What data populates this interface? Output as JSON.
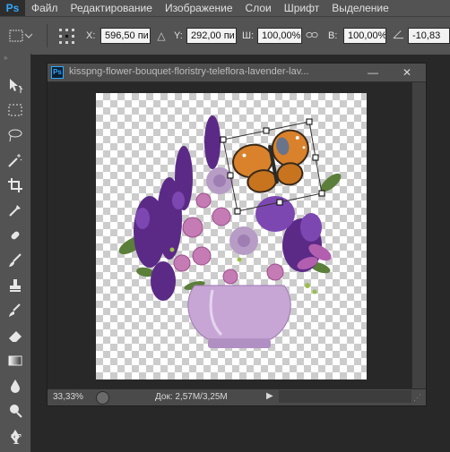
{
  "menubar": {
    "logo": "Ps",
    "items": [
      "Файл",
      "Редактирование",
      "Изображение",
      "Слои",
      "Шрифт",
      "Выделение"
    ]
  },
  "options_bar": {
    "x_label": "X:",
    "x_value": "596,50 пи",
    "y_label": "Y:",
    "y_value": "292,00 пи",
    "w_label": "Ш:",
    "w_value": "100,00%",
    "h_label": "В:",
    "h_value": "100,00%",
    "angle_value": "-10,83"
  },
  "document": {
    "ps_icon": "Ps",
    "title": "kisspng-flower-bouquet-floristry-teleflora-lavender-lav...",
    "minimize": "—",
    "close": "✕",
    "zoom": "33,33%",
    "doc_info": "Док: 2,57M/3,25M",
    "status_arrow": "▶"
  },
  "colors": {
    "ui_dark": "#282828",
    "panel": "#535353",
    "accent_ps": "#31a8ff",
    "purple_flowers": "#5b2a86",
    "butterfly_orange": "#d9822b"
  },
  "tools": [
    "move-icon",
    "marquee-icon",
    "lasso-icon",
    "magic-wand-icon",
    "crop-icon",
    "eyedropper-icon",
    "healing-brush-icon",
    "brush-icon",
    "clone-stamp-icon",
    "history-brush-icon",
    "eraser-icon",
    "gradient-icon",
    "blur-icon",
    "dodge-icon",
    "pen-icon",
    "type-icon"
  ]
}
